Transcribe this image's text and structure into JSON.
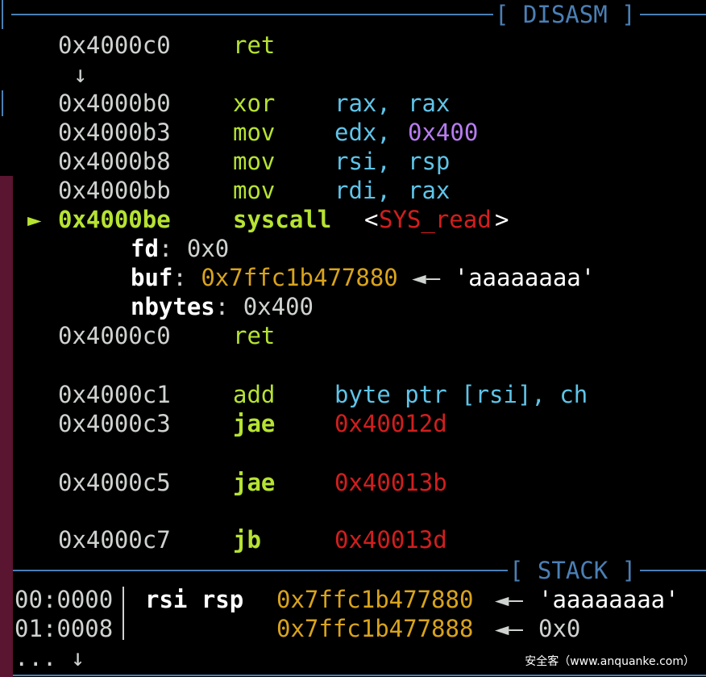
{
  "disasm": {
    "header_label": "[ DISASM ]",
    "top_ret": {
      "addr": "0x4000c0",
      "mnemonic": "ret"
    },
    "jump_arrow": "↓",
    "lines": [
      {
        "addr": "0x4000b0",
        "mnemonic": "xor",
        "op1": "rax,",
        "op2": "rax",
        "op2_color": "cyan"
      },
      {
        "addr": "0x4000b3",
        "mnemonic": "mov",
        "op1": "edx,",
        "op2": "0x400",
        "op2_color": "purple"
      },
      {
        "addr": "0x4000b8",
        "mnemonic": "mov",
        "op1": "rsi,",
        "op2": "rsp",
        "op2_color": "cyan"
      },
      {
        "addr": "0x4000bb",
        "mnemonic": "mov",
        "op1": "rdi,",
        "op2": "rax",
        "op2_color": "cyan"
      }
    ],
    "current": {
      "marker": "►",
      "addr": "0x4000be",
      "mnemonic": "syscall",
      "annotation_open": "<",
      "annotation_name": "SYS_read",
      "annotation_close": ">"
    },
    "args": [
      {
        "name": "fd",
        "sep": ":",
        "value": "0x0"
      },
      {
        "name": "buf",
        "sep": ":",
        "value": "0x7ffc1b477880",
        "arrow": "◄—",
        "deref": "'aaaaaaaa'"
      },
      {
        "name": "nbytes",
        "sep": ":",
        "value": "0x400"
      }
    ],
    "after": [
      {
        "addr": "0x4000c0",
        "mnemonic": "ret",
        "operand": ""
      },
      {
        "addr": "0x4000c1",
        "mnemonic": "add",
        "operand": "byte ptr [rsi], ch"
      },
      {
        "addr": "0x4000c3",
        "mnemonic": "jae",
        "operand": "0x40012d"
      },
      {
        "addr": "0x4000c5",
        "mnemonic": "jae",
        "operand": "0x40013b"
      },
      {
        "addr": "0x4000c7",
        "mnemonic": "jb",
        "operand": "0x40013d"
      }
    ]
  },
  "stack": {
    "header_label": "[ STACK ]",
    "rows": [
      {
        "offset": "00:0000",
        "regs": "rsi rsp",
        "addr": "0x7ffc1b477880",
        "arrow": "◄—",
        "value": "'aaaaaaaa'"
      },
      {
        "offset": "01:0008",
        "regs": "",
        "addr": "0x7ffc1b477888",
        "arrow": "◄—",
        "value": "0x0"
      }
    ],
    "ellipsis": "... ↓"
  },
  "watermark": "安全客（www.anquanke.com）",
  "colors": {
    "background": "#000000",
    "address": "#cfd3cf",
    "mnemonic": "#b6e332",
    "register": "#5fc4e8",
    "immediate": "#b87cf0",
    "jump_target": "#d21e1e",
    "pointer": "#d9a31c",
    "border": "#4b7fb5"
  }
}
